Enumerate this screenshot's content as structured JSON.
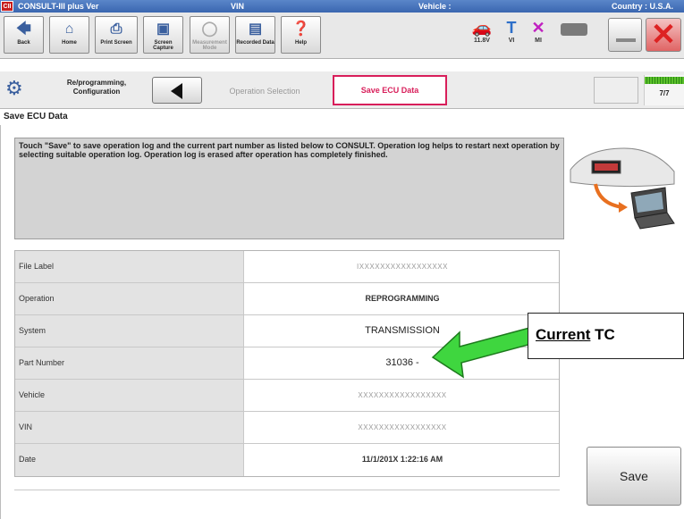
{
  "titlebar": {
    "app": "CONSULT-III plus Ver",
    "vin_label": "VIN",
    "vehicle_label": "Vehicle :",
    "country": "Country : U.S.A."
  },
  "toolbar": {
    "back": "Back",
    "home": "Home",
    "print": "Print Screen",
    "screen_capture": "Screen Capture",
    "measurement": "Measurement Mode",
    "recorded": "Recorded Data",
    "help": "Help",
    "voltage": "11.8V",
    "vi": "VI",
    "mi": "MI"
  },
  "nav": {
    "mode_label": "Re/programming, Configuration",
    "crumb_operation": "Operation Selection",
    "crumb_active": "Save ECU Data",
    "progress_text": "7/7",
    "progress": 1.0
  },
  "section_title": "Save ECU Data",
  "message": "Touch \"Save\" to save operation log and the current part number as listed below to CONSULT. Operation log helps to restart next operation by selecting suitable operation log. Operation log is erased after operation has completely finished.",
  "table": [
    {
      "label": "File Label",
      "value": "IXXXXXXXXXXXXXXXXX",
      "style": "masked"
    },
    {
      "label": "Operation",
      "value": "REPROGRAMMING",
      "style": "bold"
    },
    {
      "label": "System",
      "value": "TRANSMISSION",
      "style": "plain"
    },
    {
      "label": "Part Number",
      "value": "31036 -",
      "style": "plain"
    },
    {
      "label": "Vehicle",
      "value": "XXXXXXXXXXXXXXXXX",
      "style": "masked"
    },
    {
      "label": "VIN",
      "value": "XXXXXXXXXXXXXXXXX",
      "style": "masked"
    },
    {
      "label": "Date",
      "value": "11/1/201X 1:22:16 AM",
      "style": "bold"
    }
  ],
  "callout": {
    "underlined": "Current",
    "rest": " TC"
  },
  "save_button": "Save",
  "colors": {
    "accent": "#d81e5a",
    "arrow": "#3fd63f",
    "titlebar": "#3a66b0"
  }
}
